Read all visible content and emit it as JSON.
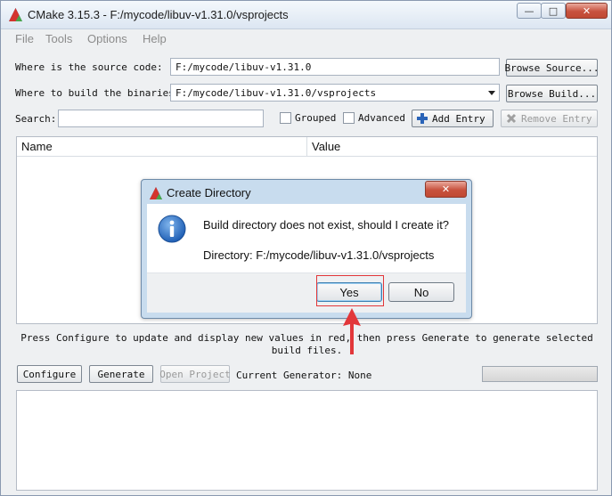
{
  "window": {
    "title": "CMake 3.15.3 - F:/mycode/libuv-v1.31.0/vsprojects",
    "minimize_glyph": "—",
    "maximize_glyph": "□",
    "close_glyph": "✕"
  },
  "menu": [
    {
      "label": "File"
    },
    {
      "label": "Tools"
    },
    {
      "label": "Options"
    },
    {
      "label": "Help"
    }
  ],
  "source": {
    "label": "Where is the source code:",
    "value": "F:/mycode/libuv-v1.31.0",
    "browse_label": "Browse Source..."
  },
  "build": {
    "label": "Where to build the binaries:",
    "value": "F:/mycode/libuv-v1.31.0/vsprojects",
    "browse_label": "Browse Build..."
  },
  "search": {
    "label": "Search:",
    "value": "",
    "grouped_label": "Grouped",
    "grouped_checked": false,
    "advanced_label": "Advanced",
    "advanced_checked": false,
    "add_entry_label": "Add Entry",
    "remove_entry_label": "Remove Entry"
  },
  "table": {
    "columns": [
      "Name",
      "Value"
    ]
  },
  "hint": "Press Configure to update and display new values in red, then press Generate to generate selected build files.",
  "bottom": {
    "configure_label": "Configure",
    "generate_label": "Generate",
    "open_project_label": "Open Project",
    "generator_text": "Current Generator: None"
  },
  "dialog": {
    "title": "Create Directory",
    "message": "Build directory does not exist, should I create it?",
    "directory": "Directory: F:/mycode/libuv-v1.31.0/vsprojects",
    "yes_label": "Yes",
    "no_label": "No",
    "close_glyph": "✕"
  },
  "colors": {
    "annotation_red": "#e2373a"
  }
}
